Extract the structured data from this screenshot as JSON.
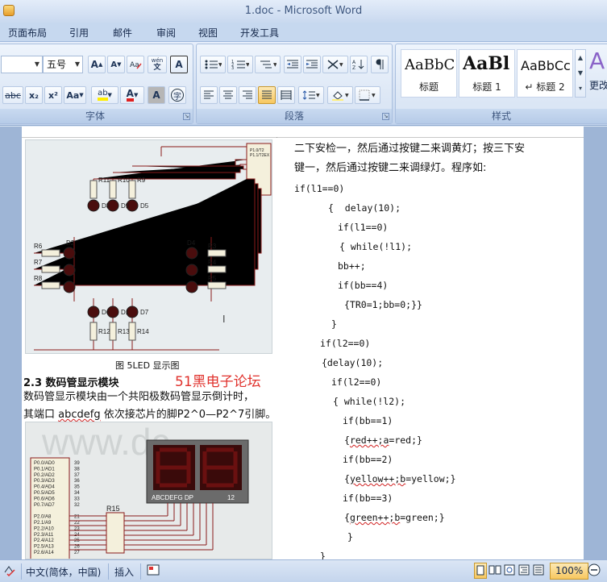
{
  "window": {
    "title": "1.doc - Microsoft Word"
  },
  "tabs": [
    "页面布局",
    "引用",
    "邮件",
    "审阅",
    "视图",
    "开发工具"
  ],
  "font_group": {
    "label": "字体",
    "size_value": "五号",
    "grow_label": "A",
    "shrink_label": "A",
    "phonetic_label": "wén",
    "strike_label": "abc",
    "sub_label": "x₂",
    "sup_label": "x²",
    "case_label": "Aa",
    "highlight_label": "ab",
    "color_label": "A",
    "char_shade_label": "A",
    "enclose_label": "字"
  },
  "paragraph_group": {
    "label": "段落"
  },
  "styles_group": {
    "label": "样式",
    "tiles": [
      {
        "sample": "AaBbC",
        "name": "标题"
      },
      {
        "sample": "AaBl",
        "name": "标题 1"
      },
      {
        "sample": "AaBbCc",
        "name": "↵ 标题 2"
      }
    ],
    "more_label": "更改"
  },
  "document": {
    "figure_caption": "图 5LED 显示图",
    "section_heading": "2.3 数码管显示模块",
    "watermark": "51黑电子论坛",
    "body_lines": [
      "数码管显示模块由一个共阳极数码管显示倒计时，",
      "其端口 abcdefg 依次接芯片的脚P2^0—P2^7引脚。"
    ],
    "right_intro": [
      "二下安检一，然后通过按键二来调黄灯；按三下安",
      "键一，然后通过按键二来调绿灯。程序如:"
    ],
    "code_lines": [
      "if(l1==0)",
      "  {  delay(10);",
      "     if(l1==0)",
      "     { while(!l1);",
      "     bb++;",
      "     if(bb==4)",
      "      {TR0=1;bb=0;}}",
      "   }",
      "if(l2==0)",
      "{delay(10);",
      "  if(l2==0)",
      "  { while(!l2);",
      "     if(bb==1)",
      "     {red++;a=red;}",
      "     if(bb==2)",
      "     {yellow++;b=yellow;}",
      "     if(bb==3)",
      "     {green++;b=green;}",
      "      }",
      "   }"
    ],
    "schematic_labels": {
      "resistors_top": [
        "R11",
        "R10",
        "R9"
      ],
      "leds_top": [
        "D8",
        "D9",
        "D5"
      ],
      "left_leds": [
        "D2"
      ],
      "left_resistors": [
        "R6",
        "R7",
        "R8"
      ],
      "right_leds": [
        "D4"
      ],
      "right_resistors": [
        "R3",
        "R4",
        "R5"
      ],
      "leds_bottom": [
        "D6",
        "D1",
        "D7"
      ],
      "resistors_bottom": [
        "R12",
        "R13",
        "R14"
      ],
      "seg_label": "ABCDEFG DP",
      "seg_digits": "12",
      "r15": "R15",
      "ports": [
        "P0.0/AD0",
        "P0.1/AD1",
        "P0.2/AD2",
        "P0.3/AD3",
        "P0.4/AD4",
        "P0.5/AD5",
        "P0.6/AD6",
        "P0.7/AD7",
        "",
        "P2.0/A8",
        "P2.1/A9",
        "P2.2/A10",
        "P2.3/A11",
        "P2.4/A12",
        "P2.5/A13",
        "P2.6/A14"
      ],
      "pins": [
        "39",
        "38",
        "37",
        "36",
        "35",
        "34",
        "33",
        "32",
        "",
        "21",
        "22",
        "23",
        "24",
        "25",
        "26",
        "27"
      ]
    }
  },
  "statusbar": {
    "lang": "中文(简体，中国)",
    "insert": "插入",
    "zoom": "100%"
  }
}
